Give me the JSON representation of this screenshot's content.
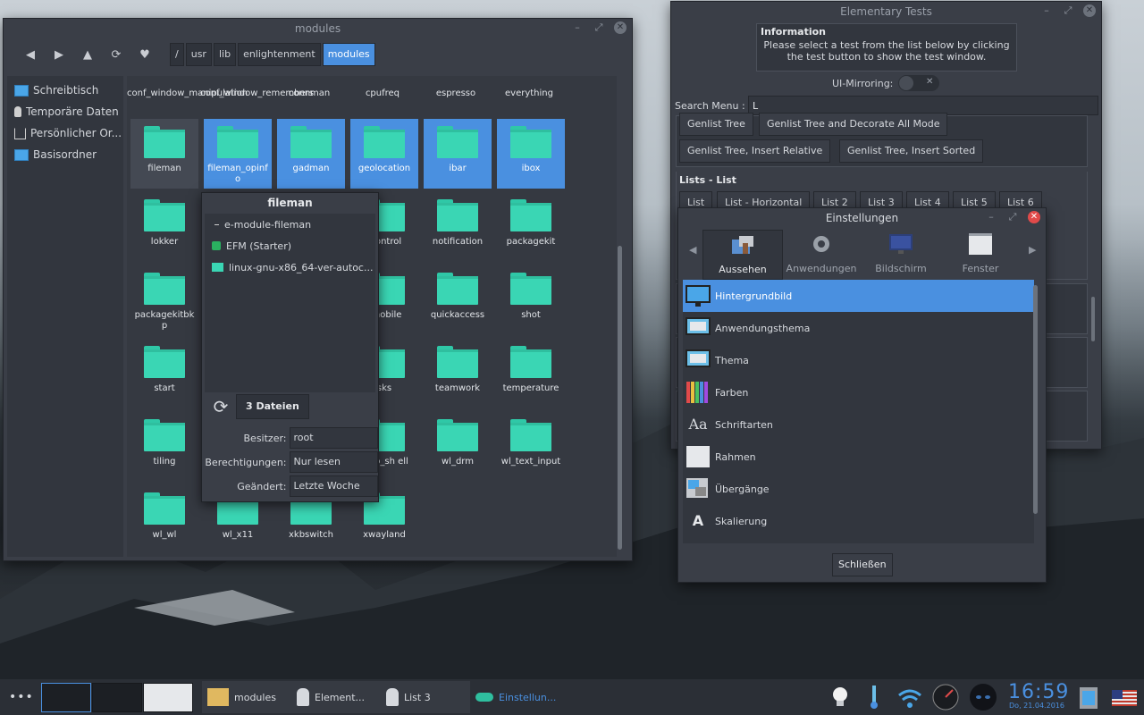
{
  "fm": {
    "title": "modules",
    "breadcrumbs": [
      "/",
      "usr",
      "lib",
      "enlightenment",
      "modules"
    ],
    "sidebar": [
      "Schreibtisch",
      "Temporäre Daten",
      "Persönlicher Or...",
      "Basisordner"
    ],
    "row0": [
      "conf_window_manipulation",
      "conf_window_remembers",
      "connman",
      "cpufreq",
      "espresso",
      "everything"
    ],
    "row1": [
      "fileman",
      "fileman_opinfo",
      "gadman",
      "geolocation",
      "ibar",
      "ibox"
    ],
    "row2": [
      "lokker",
      "-control",
      "notification",
      "packagekit"
    ],
    "row3": [
      "packagekitbkp",
      "_mobile",
      "quickaccess",
      "shot"
    ],
    "row4": [
      "start",
      "sks",
      "teamwork",
      "temperature"
    ],
    "row5": [
      "tiling",
      "ktop_sh ell",
      "wl_drm",
      "wl_text_input"
    ],
    "row6": [
      "wl_wl",
      "wl_x11",
      "xkbswitch",
      "xwayland"
    ]
  },
  "popup": {
    "title": "fileman",
    "items": [
      "e-module-fileman",
      "EFM (Starter)",
      "linux-gnu-x86_64-ver-autoc..."
    ],
    "files_button": "3 Dateien",
    "props": [
      {
        "label": "Besitzer:",
        "value": "root"
      },
      {
        "label": "Berechtigungen:",
        "value": "Nur lesen"
      },
      {
        "label": "Geändert:",
        "value": "Letzte Woche"
      }
    ]
  },
  "et": {
    "title": "Elementary Tests",
    "info_title": "Information",
    "info_text1": "Please select a test from the list below by clicking",
    "info_text2": "the test button to show the test window.",
    "mirroring": "UI-Mirroring:",
    "search_label": "Search Menu :",
    "search_value": "L",
    "btns_top": [
      "Genlist Tree",
      "Genlist Tree and Decorate All Mode"
    ],
    "btns_mid": [
      "Genlist Tree, Insert Relative",
      "Genlist Tree, Insert Sorted"
    ],
    "section": "Lists - List",
    "list_btns": [
      "List",
      "List - Horizontal",
      "List 2",
      "List 3",
      "List 4",
      "List 5",
      "List 6"
    ]
  },
  "ein": {
    "title": "Einstellungen",
    "tabs": [
      "Aussehen",
      "Anwendungen",
      "Bildschirm",
      "Fenster"
    ],
    "items": [
      "Hintergrundbild",
      "Anwendungsthema",
      "Thema",
      "Farben",
      "Schriftarten",
      "Rahmen",
      "Übergänge",
      "Skalierung"
    ],
    "close": "Schließen"
  },
  "taskbar": {
    "tasks": [
      "modules",
      "Element...",
      "List 3",
      "Einstellun..."
    ],
    "time": "16:59",
    "date": "Do, 21.04.2016"
  },
  "colors": {
    "accent": "#4a90e0",
    "folder": "#3ad6b4",
    "close": "#e04a4a"
  }
}
